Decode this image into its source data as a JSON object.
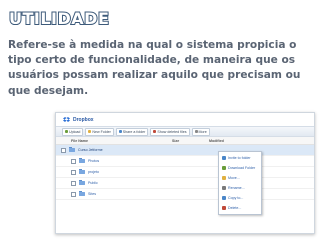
{
  "slide": {
    "title": "UTILIDADE",
    "body": "Refere-se à medida na qual o sistema propicia o tipo certo de funcionalidade, de maneira que os usuários possam realizar aquilo que precisam ou que desejam."
  },
  "app": {
    "name": "Dropbox",
    "toolbar": [
      {
        "label": "Upload",
        "icon": "upload-icon",
        "color": "#6a9d3a"
      },
      {
        "label": "New Folder",
        "icon": "new-folder-icon",
        "color": "#e0b040"
      },
      {
        "label": "Share a folder",
        "icon": "share-folder-icon",
        "color": "#4a86c8"
      },
      {
        "label": "Show deleted files",
        "icon": "trash-icon",
        "color": "#c04a3a"
      },
      {
        "label": "More",
        "icon": "chevron-down-icon",
        "color": "#888888"
      }
    ],
    "columns": {
      "name": "File Name",
      "size": "Size",
      "modified": "Modified"
    },
    "files": [
      {
        "name": "Curso Jetforme",
        "selected": true,
        "indent": false
      },
      {
        "name": "Photos",
        "selected": false,
        "indent": true
      },
      {
        "name": "projeto",
        "selected": false,
        "indent": true
      },
      {
        "name": "Public",
        "selected": false,
        "indent": true
      },
      {
        "name": "Sites",
        "selected": false,
        "indent": true
      }
    ],
    "context_menu": [
      {
        "label": "Invite to folder",
        "icon": "invite-icon",
        "color": "#4a86c8"
      },
      {
        "label": "Download Folder",
        "icon": "download-icon",
        "color": "#6a9d3a"
      },
      {
        "label": "Move...",
        "icon": "move-icon",
        "color": "#e0b040"
      },
      {
        "label": "Rename...",
        "icon": "rename-icon",
        "color": "#7a7a7a"
      },
      {
        "label": "Copy to...",
        "icon": "copy-icon",
        "color": "#4a86c8"
      },
      {
        "label": "Delete...",
        "icon": "delete-icon",
        "color": "#c04a3a"
      }
    ]
  },
  "colors": {
    "title_outline": "#3d5a7a",
    "body_text": "#5a6473",
    "link": "#2e5fa8"
  }
}
